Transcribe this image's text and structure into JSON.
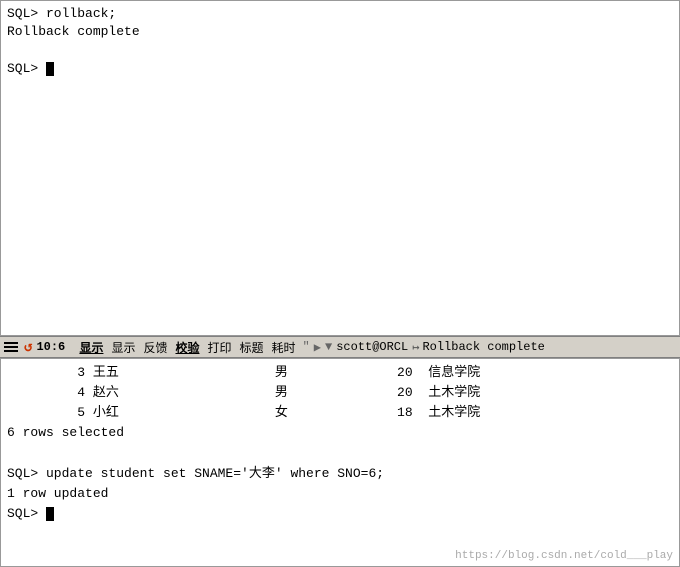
{
  "top_terminal": {
    "lines": [
      "SQL> rollback;",
      "Rollback complete",
      "",
      "SQL> "
    ]
  },
  "status_bar": {
    "position": "10:6",
    "buttons": [
      "显示",
      "显示",
      "反馈",
      "校验",
      "打印",
      "标题",
      "耗时"
    ],
    "separator1": "\"",
    "separator2": "▶",
    "separator3": "▼",
    "user": "scott@ORCL",
    "pin_icon": "↦",
    "rollback_text": "Rollback complete"
  },
  "bottom_terminal": {
    "lines": [
      "         3 王五                    男              20  信息学院",
      "         4 赵六                    男              20  土木学院",
      "         5 小红                    女              18  土木学院",
      "6 rows selected",
      "",
      "SQL> update student set SNAME='大李' where SNO=6;",
      "1 row updated",
      "SQL> "
    ],
    "watermark": "https://blog.csdn.net/cold___play"
  }
}
